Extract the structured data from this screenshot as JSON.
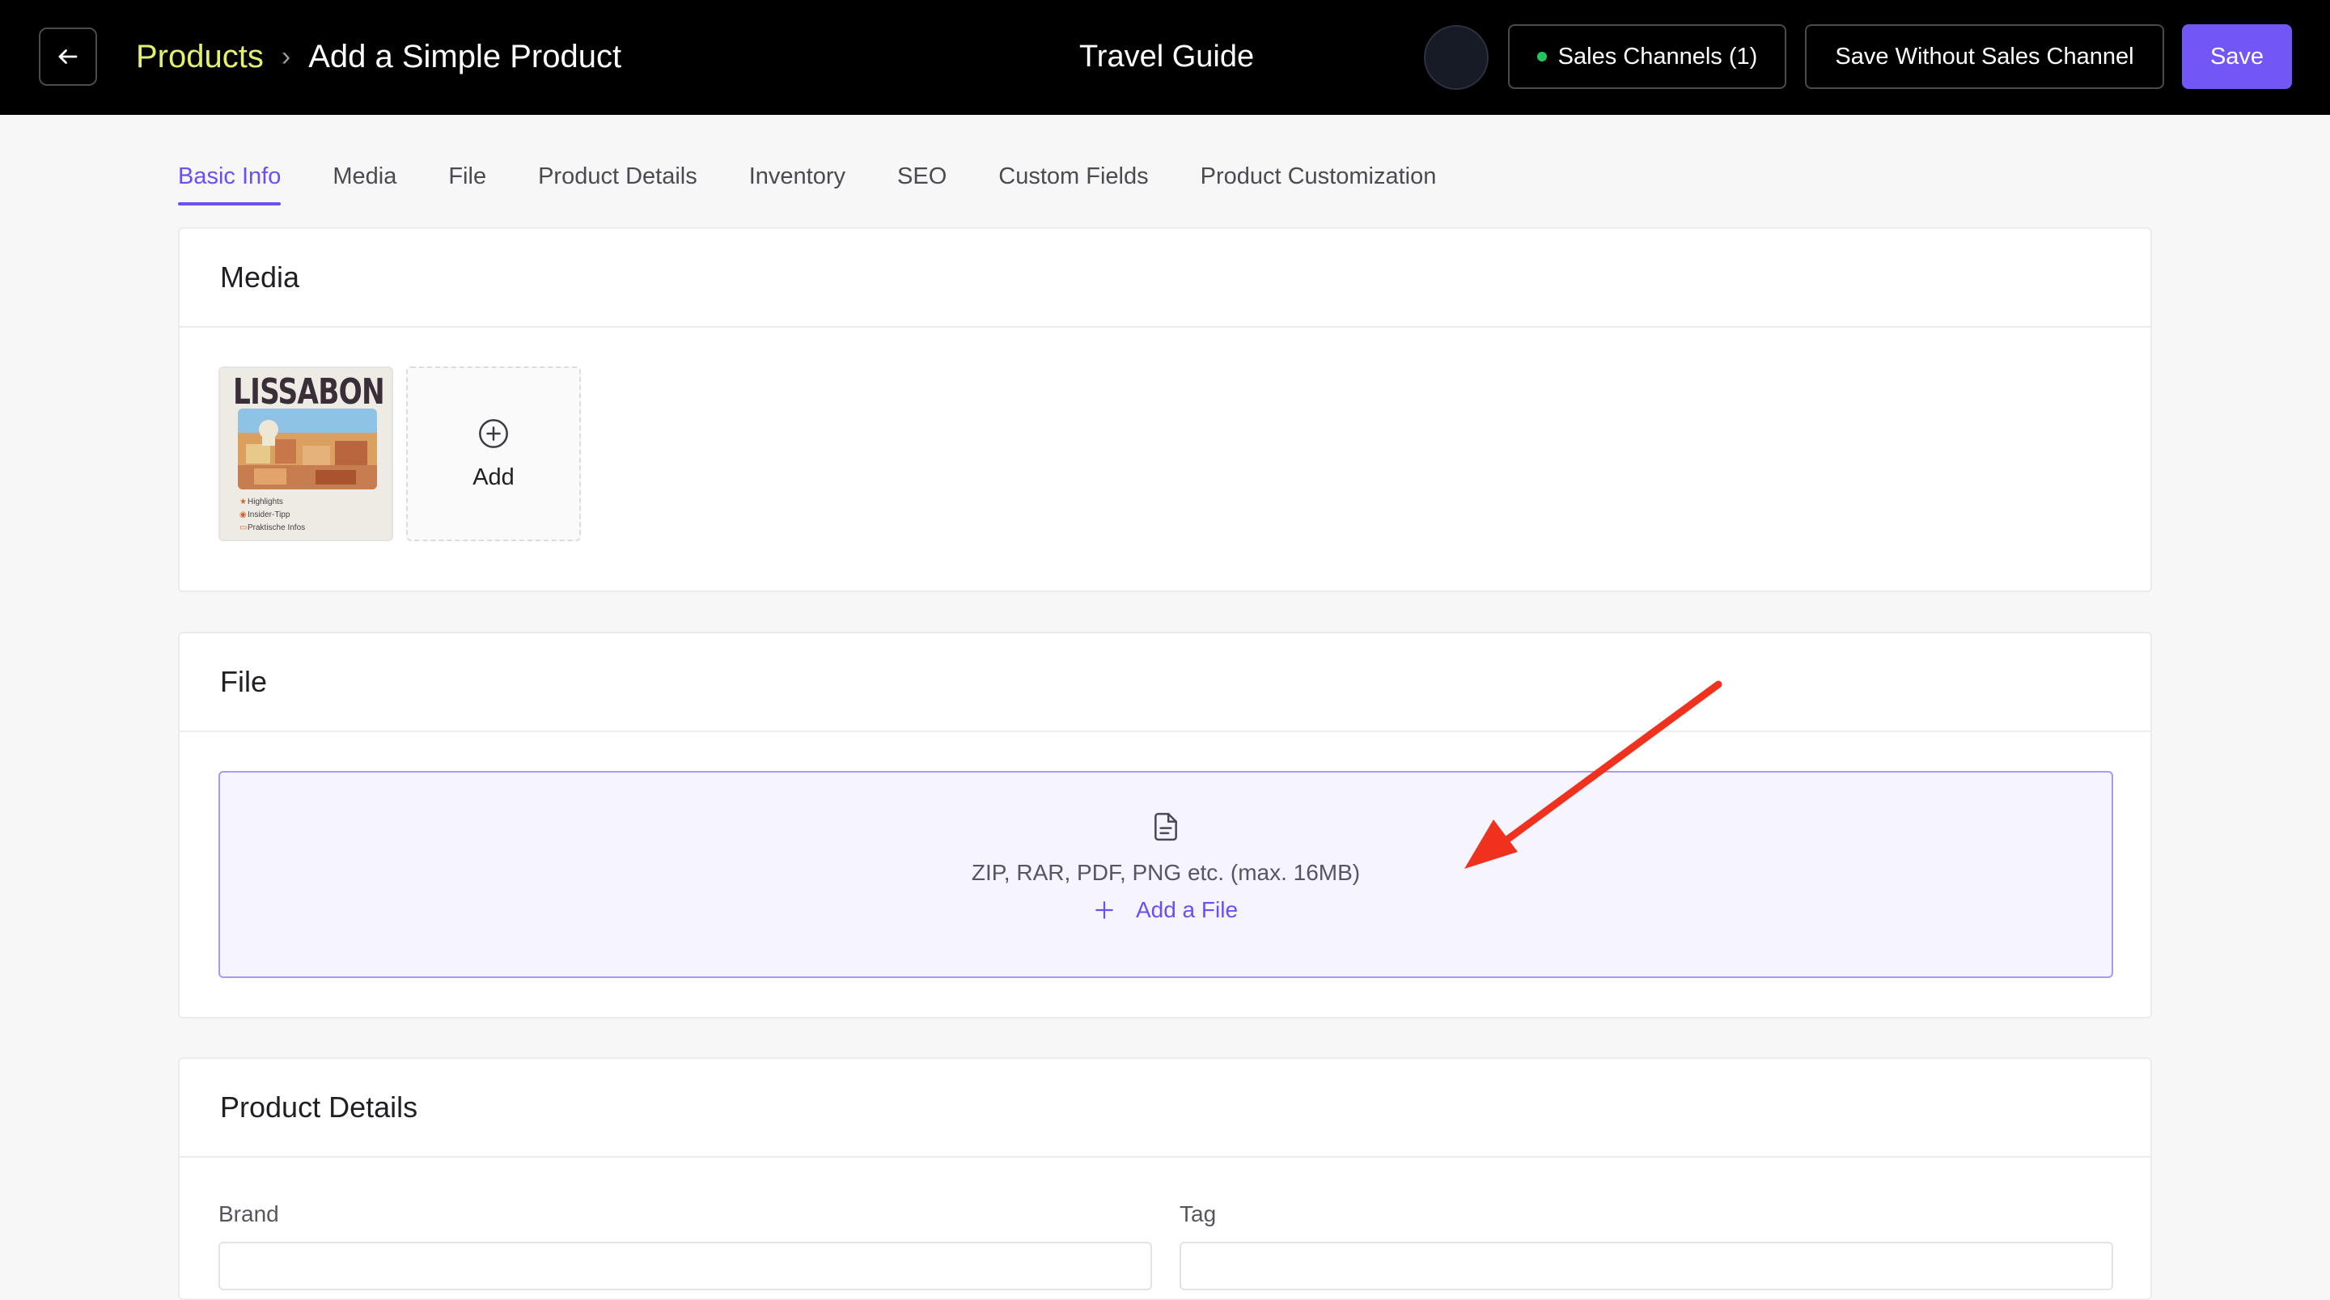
{
  "header": {
    "breadcrumb_parent": "Products",
    "breadcrumb_separator": "›",
    "breadcrumb_current": "Add a Simple Product",
    "document_title": "Travel Guide",
    "sales_channels_label": "Sales Channels (1)",
    "save_without_channel_label": "Save Without Sales Channel",
    "save_label": "Save"
  },
  "tabs": [
    {
      "label": "Basic Info",
      "active": true
    },
    {
      "label": "Media"
    },
    {
      "label": "File"
    },
    {
      "label": "Product Details"
    },
    {
      "label": "Inventory"
    },
    {
      "label": "SEO"
    },
    {
      "label": "Custom Fields"
    },
    {
      "label": "Product Customization"
    }
  ],
  "media": {
    "title": "Media",
    "thumbnail": {
      "title": "LISSABON",
      "lines": [
        "Highlights",
        "Insider-Tipp",
        "Praktische Infos"
      ]
    },
    "add_label": "Add"
  },
  "file": {
    "title": "File",
    "hint": "ZIP, RAR, PDF, PNG etc. (max. 16MB)",
    "add_label": "Add a File"
  },
  "details": {
    "title": "Product Details",
    "brand_label": "Brand",
    "tag_label": "Tag"
  },
  "colors": {
    "accent": "#6b4ff0",
    "breadcrumb_link": "#e4f06b",
    "status_dot": "#22c55e",
    "annotation_arrow": "#f0311e"
  },
  "icons": {
    "back": "arrow-left-icon",
    "add_media": "plus-circle-icon",
    "file": "file-text-icon",
    "add_file": "plus-icon"
  }
}
